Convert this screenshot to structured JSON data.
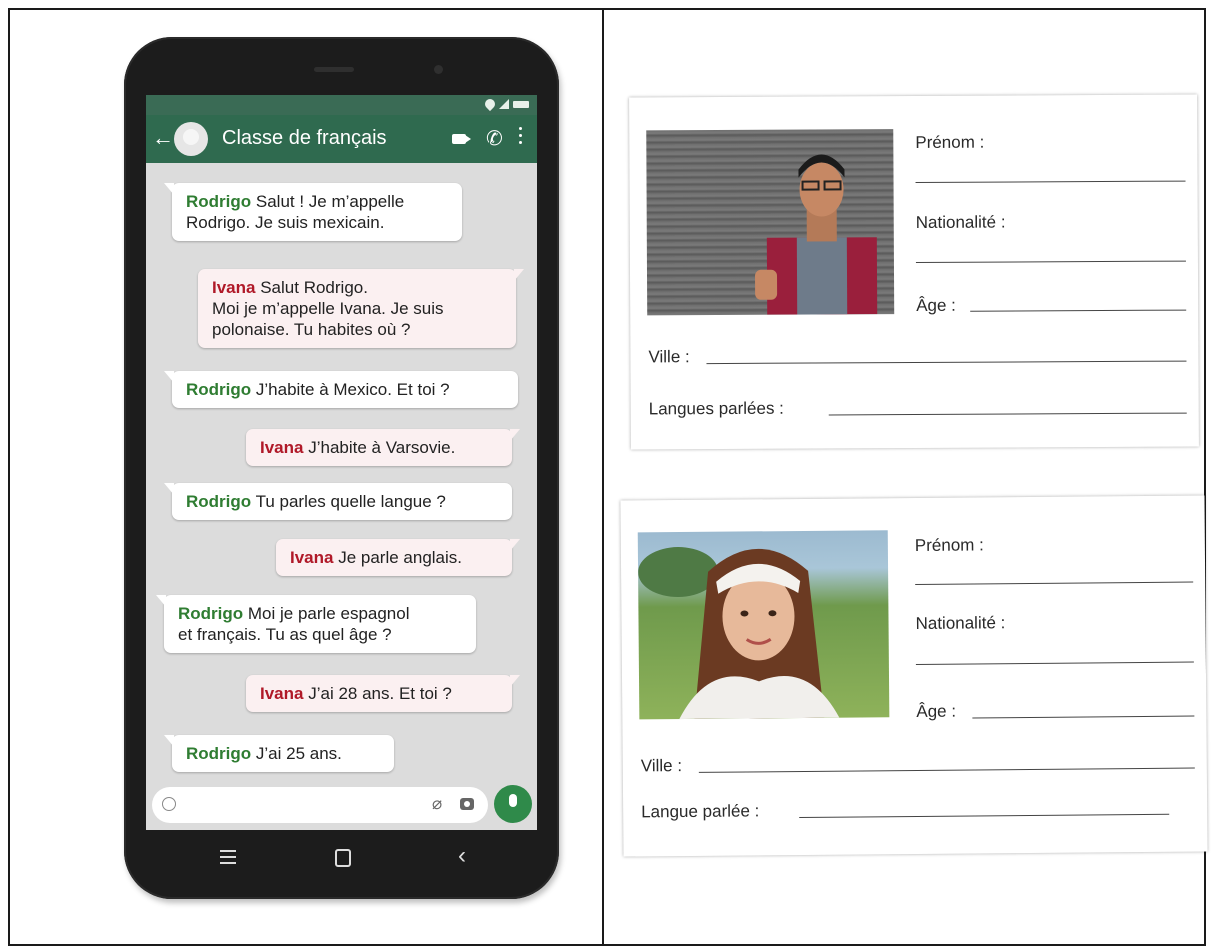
{
  "chat": {
    "title": "Classe de français",
    "messages": [
      {
        "sender": "Rodrigo",
        "text": "Salut ! Je m’appelle\nRodrigo. Je suis mexicain."
      },
      {
        "sender": "Ivana",
        "text": "Salut Rodrigo.\nMoi je m’appelle Ivana. Je suis\npolonaise. Tu habites où ?"
      },
      {
        "sender": "Rodrigo",
        "text": "J’habite à Mexico. Et toi ?"
      },
      {
        "sender": "Ivana",
        "text": "J’habite à Varsovie."
      },
      {
        "sender": "Rodrigo",
        "text": "Tu parles quelle langue ?"
      },
      {
        "sender": "Ivana",
        "text": "Je parle anglais."
      },
      {
        "sender": "Rodrigo",
        "text": "Moi je parle espagnol\net français. Tu as quel âge ?"
      },
      {
        "sender": "Ivana",
        "text": "J’ai 28 ans. Et toi ?"
      },
      {
        "sender": "Rodrigo",
        "text": "J’ai 25 ans."
      }
    ]
  },
  "card1": {
    "prenom": "Prénom :",
    "nationalite": "Nationalité :",
    "age": "Âge :",
    "ville": "Ville :",
    "langues": "Langues parlées :"
  },
  "card2": {
    "prenom": "Prénom :",
    "nationalite": "Nationalité :",
    "age": "Âge :",
    "ville": "Ville :",
    "langue": "Langue parlée :"
  },
  "colors": {
    "rodrigo": "#2f7d32",
    "ivana": "#b01928",
    "appbar": "#2f6a4f"
  }
}
